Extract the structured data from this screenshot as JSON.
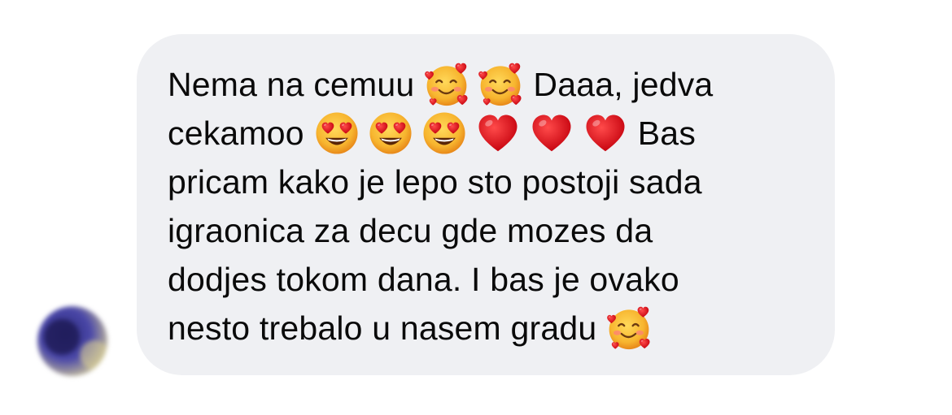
{
  "message": {
    "line1": {
      "a": "Nema na cemuu",
      "b": "Daaa, jedva"
    },
    "line2": {
      "a": "cekamoo",
      "b": "Bas"
    },
    "line3": "pricam kako je lepo sto postoji sada",
    "line4": "igraonica za decu gde mozes da",
    "line5": "dodjes tokom dana. I bas je ovako",
    "line6": "nesto trebalo u nasem gradu",
    "emojis": [
      "smiling-face-with-hearts",
      "smiling-face-with-hearts",
      "heart-eyes",
      "heart-eyes",
      "heart-eyes",
      "red-heart",
      "red-heart",
      "red-heart",
      "smiling-face-with-hearts"
    ]
  },
  "colors": {
    "bubble": "#eff0f3",
    "text": "#0a0a0a",
    "heart": "#e0161e",
    "emoji_face": "#f7b93a"
  }
}
